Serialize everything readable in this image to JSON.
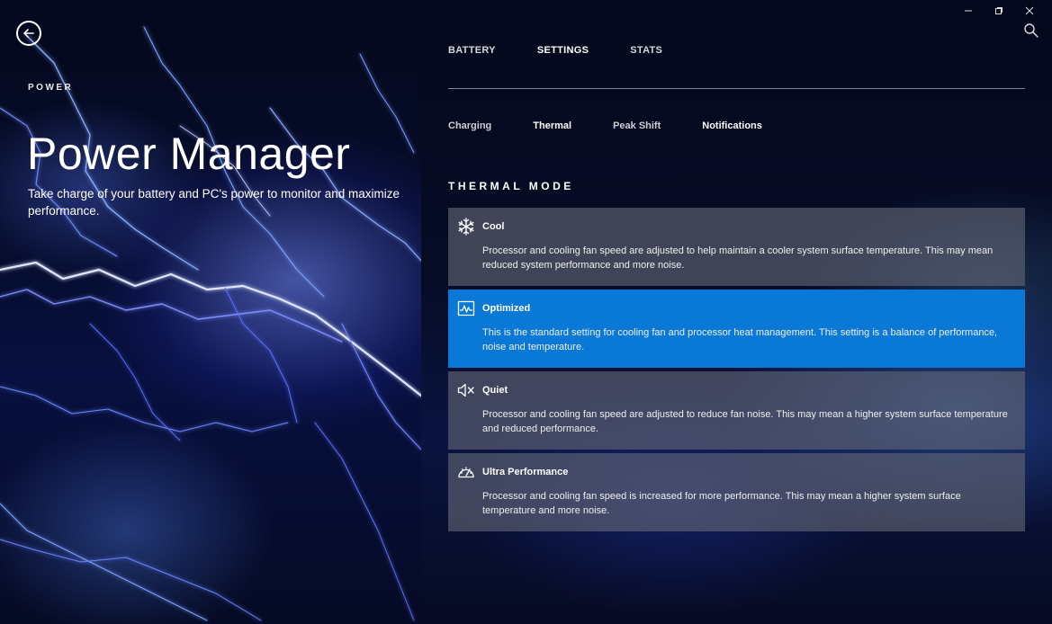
{
  "hero": {
    "kicker": "POWER",
    "title": "Power Manager",
    "description": "Take charge of your battery and PC's power to monitor and maximize performance."
  },
  "window": {
    "minimize_icon": "minimize-icon",
    "maximize_icon": "maximize-icon",
    "close_icon": "close-icon",
    "search_icon": "search-icon"
  },
  "tabs": [
    {
      "label": "BATTERY",
      "active": false
    },
    {
      "label": "SETTINGS",
      "active": true
    },
    {
      "label": "STATS",
      "active": false
    }
  ],
  "subtabs": [
    {
      "label": "Charging",
      "active": false
    },
    {
      "label": "Thermal",
      "active": true
    },
    {
      "label": "Peak Shift",
      "active": false
    },
    {
      "label": "Notifications",
      "active": false
    }
  ],
  "thermal": {
    "heading": "THERMAL MODE",
    "modes": [
      {
        "name": "Cool",
        "icon": "snowflake-icon",
        "description": "Processor and cooling fan speed are adjusted to help maintain a cooler system surface temperature. This may mean reduced system performance and more noise.",
        "selected": false
      },
      {
        "name": "Optimized",
        "icon": "pulse-monitor-icon",
        "description": "This is the standard setting for cooling fan and processor heat management. This setting is a balance of performance, noise and temperature.",
        "selected": true
      },
      {
        "name": "Quiet",
        "icon": "speaker-mute-icon",
        "description": "Processor and cooling fan speed are adjusted to reduce fan noise. This may mean a higher system surface temperature and reduced performance.",
        "selected": false
      },
      {
        "name": "Ultra Performance",
        "icon": "speedometer-icon",
        "description": "Processor and cooling fan speed is increased for more performance. This may mean a higher system surface temperature and more noise.",
        "selected": false
      }
    ]
  },
  "colors": {
    "selected_card": "#0a78d6",
    "card": "#646876"
  }
}
